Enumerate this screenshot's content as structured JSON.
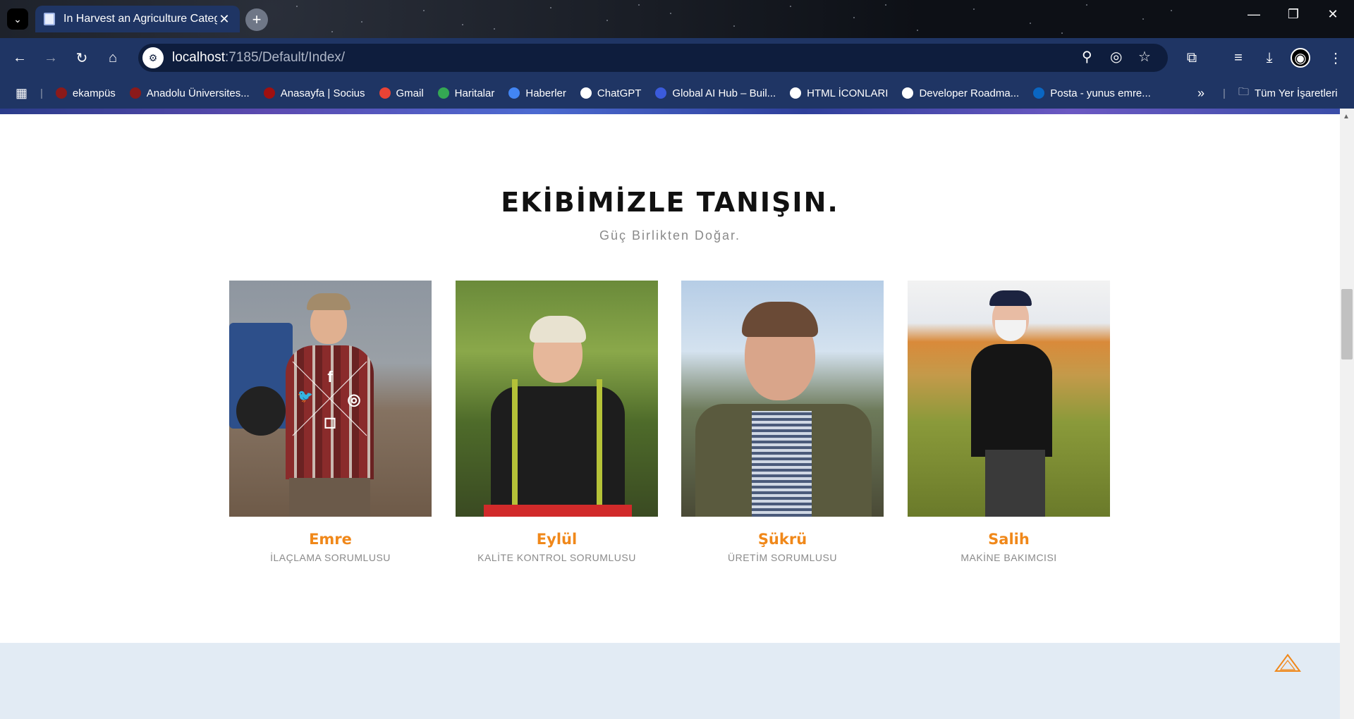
{
  "browser": {
    "tab_title": "In Harvest an Agriculture Categ",
    "url_host": "localhost",
    "url_path": ":7185/Default/Index/",
    "bookmarks": [
      {
        "label": "ekampüs",
        "color": "#8b1a1a"
      },
      {
        "label": "Anadolu Üniversites...",
        "color": "#8b1a1a"
      },
      {
        "label": "Anasayfa | Socius",
        "color": "#a01010"
      },
      {
        "label": "Gmail",
        "color": "#ea4335"
      },
      {
        "label": "Haritalar",
        "color": "#34a853"
      },
      {
        "label": "Haberler",
        "color": "#4285f4"
      },
      {
        "label": "ChatGPT",
        "color": "#ffffff"
      },
      {
        "label": "Global AI Hub – Buil...",
        "color": "#3b5bdb"
      },
      {
        "label": "HTML İCONLARI",
        "color": "#ffffff"
      },
      {
        "label": "Developer Roadma...",
        "color": "#ffffff"
      },
      {
        "label": "Posta - yunus emre...",
        "color": "#0a66c2"
      }
    ],
    "all_bookmarks": "Tüm Yer İşaretleri"
  },
  "section": {
    "title": "EKİBİMİZLE TANIŞIN.",
    "subtitle": "Güç Birlikten Doğar."
  },
  "team": [
    {
      "name": "Emre",
      "role": "İLAÇLAMA SORUMLUSU"
    },
    {
      "name": "Eylül",
      "role": "KALİTE KONTROL SORUMLUSU"
    },
    {
      "name": "Şükrü",
      "role": "ÜRETİM SORUMLUSU"
    },
    {
      "name": "Salih",
      "role": "MAKİNE BAKIMCISI"
    }
  ],
  "social": {
    "facebook": "f",
    "twitter": "🐦",
    "dribbble": "◎",
    "instagram": "◻"
  },
  "colors": {
    "accent": "#f0881a",
    "browser_chrome": "#1f3564",
    "footer_band": "#e2ebf4"
  }
}
